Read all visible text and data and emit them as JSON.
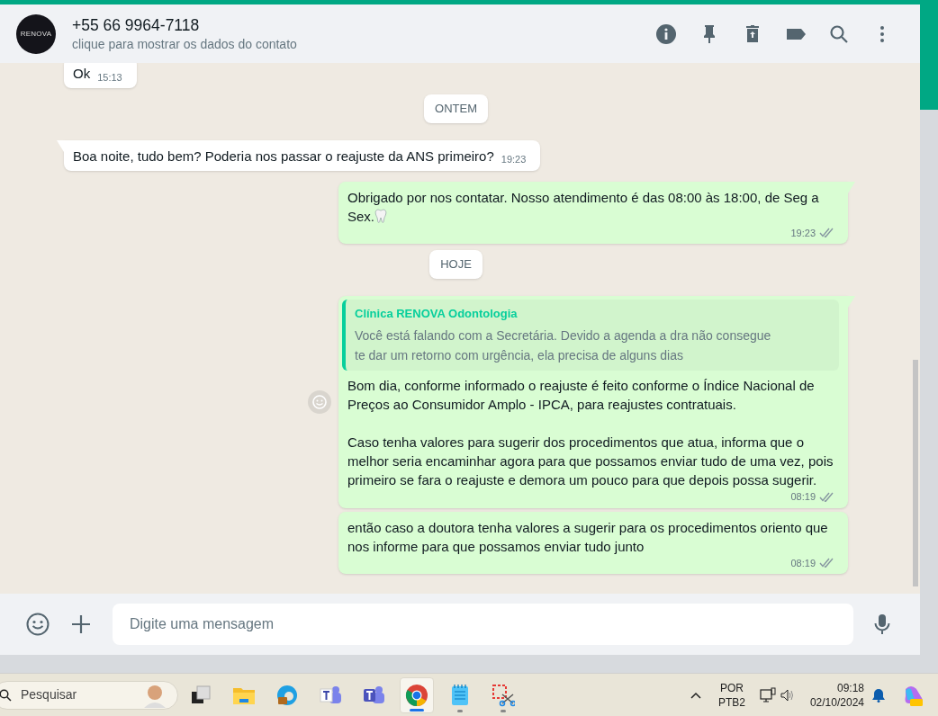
{
  "header": {
    "avatar_text": "RENOVA",
    "title": "+55 66 9964-7118",
    "subtitle": "clique para mostrar os dados do contato"
  },
  "messages": [
    {
      "kind": "incoming",
      "text": "Ok",
      "time": "15:13",
      "tail": false
    },
    {
      "kind": "date",
      "text": "ONTEM"
    },
    {
      "kind": "incoming",
      "text": "Boa noite, tudo bem? Poderia nos passar o reajuste da ANS primeiro?",
      "time": "19:23",
      "tail": true
    },
    {
      "kind": "outgoing",
      "text": "Obrigado por nos contatar. Nosso atendimento é das 08:00 às 18:00, de Seg a Sex.",
      "tooth_emoji": true,
      "time": "19:23",
      "tail": true
    },
    {
      "kind": "date",
      "text": "HOJE"
    },
    {
      "kind": "outgoing",
      "quote": {
        "author": "Clínica RENOVA Odontologia",
        "text": "Você está falando com a Secretária. Devido a agenda a dra não consegue\nte dar um retorno com urgência, ela precisa de alguns dias"
      },
      "text": "Bom dia, conforme informado o reajuste é feito conforme o Índice Nacional de Preços ao Consumidor Amplo - IPCA, para reajustes contratuais.\n\nCaso tenha valores para sugerir dos procedimentos que atua, informa que o melhor seria encaminhar agora para que possamos enviar tudo de uma vez, pois primeiro se fara o reajuste e demora um pouco para que depois possa sugerir.",
      "time": "08:19",
      "tail": true,
      "react_button": true
    },
    {
      "kind": "outgoing",
      "text": "então caso a doutora tenha valores a sugerir para os procedimentos oriento que nos informe para que possamos enviar tudo junto",
      "time": "08:19",
      "tail": false
    }
  ],
  "composer": {
    "placeholder": "Digite uma mensagem"
  },
  "taskbar": {
    "search_placeholder": "Pesquisar",
    "apps": [
      {
        "kind": "task-view",
        "selected": false,
        "running": false
      },
      {
        "kind": "folder",
        "selected": false,
        "running": false
      },
      {
        "kind": "edge",
        "selected": false,
        "running": false
      },
      {
        "kind": "teams-work",
        "selected": false,
        "running": false
      },
      {
        "kind": "teams",
        "selected": false,
        "running": false
      },
      {
        "kind": "chrome",
        "selected": true,
        "running": true
      },
      {
        "kind": "notepad",
        "selected": false,
        "running": true
      },
      {
        "kind": "snip",
        "selected": false,
        "running": true
      }
    ],
    "language": [
      "POR",
      "PTB2"
    ],
    "time": "09:18",
    "date": "02/10/2024"
  }
}
